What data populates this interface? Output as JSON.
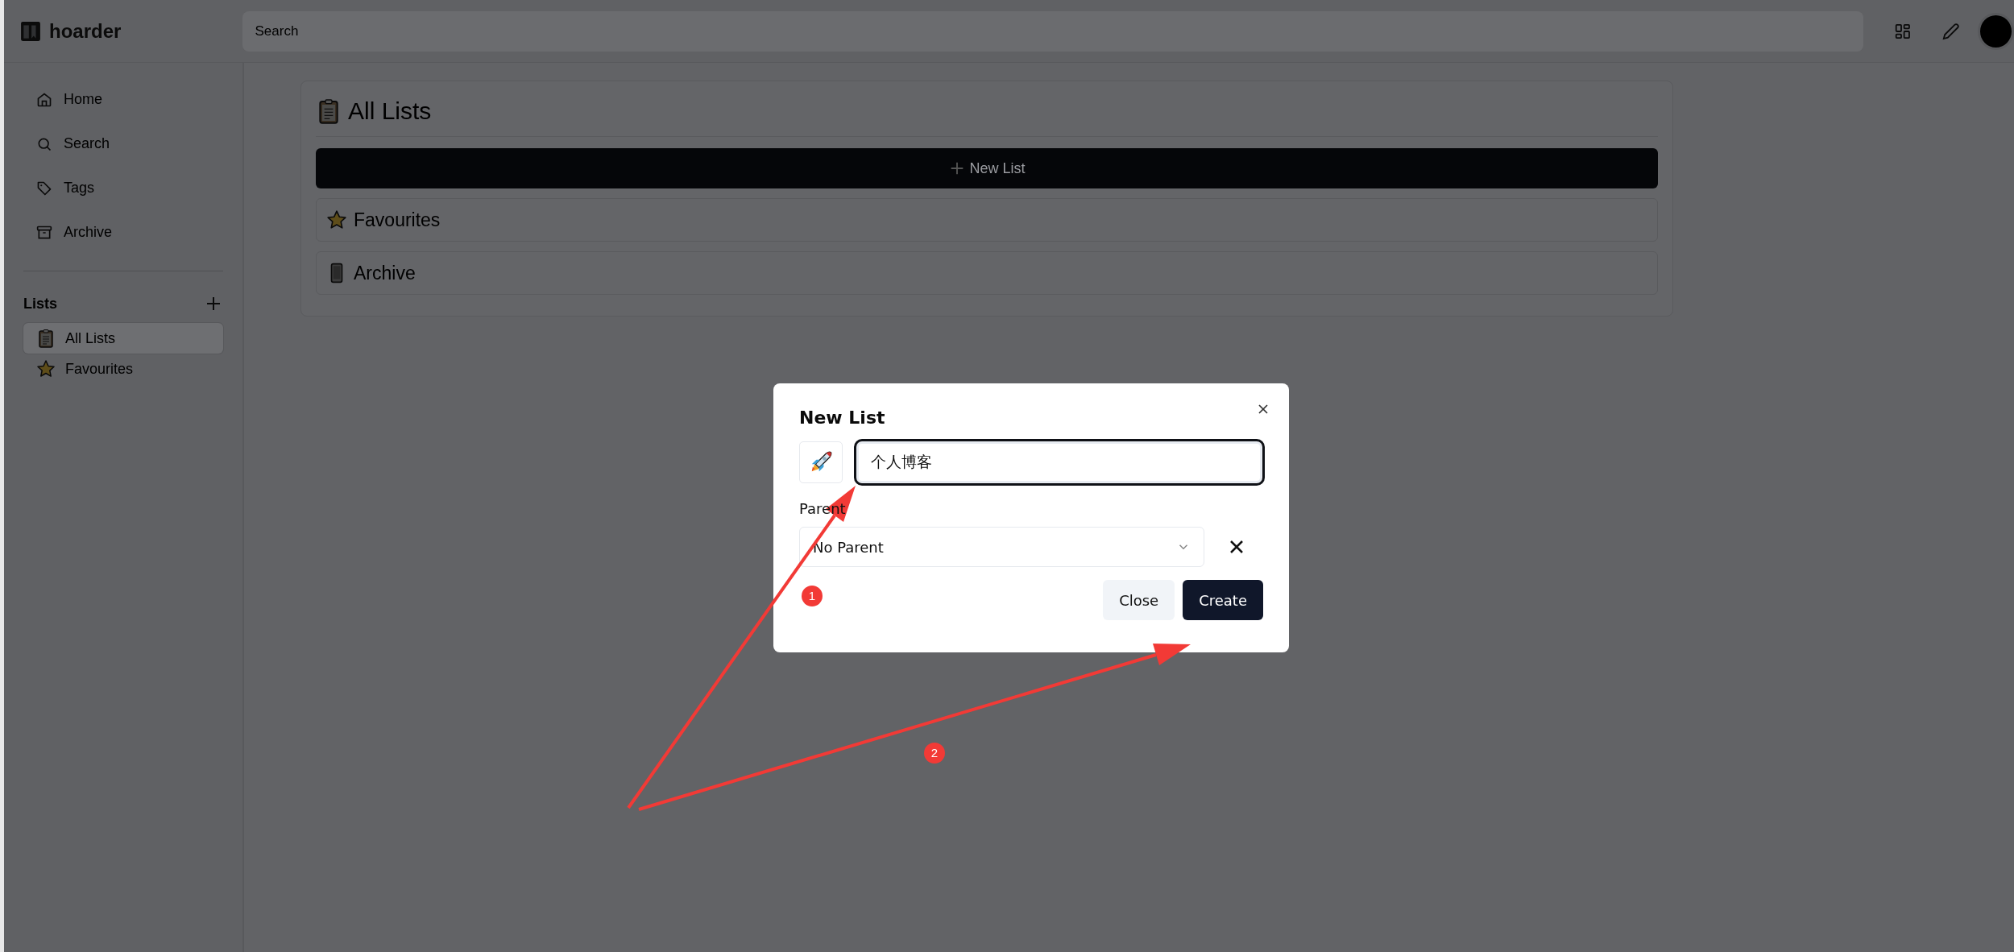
{
  "app": {
    "logo": "hoarder"
  },
  "search": {
    "placeholder": "Search"
  },
  "sidebar": {
    "items": [
      {
        "label": "Home"
      },
      {
        "label": "Search"
      },
      {
        "label": "Tags"
      },
      {
        "label": "Archive"
      }
    ],
    "lists_heading": "Lists",
    "lists": [
      {
        "label": "All Lists",
        "selected": true
      },
      {
        "label": "Favourites",
        "selected": false
      }
    ]
  },
  "page": {
    "title": "All Lists",
    "new_list_button": "New List",
    "lists": [
      {
        "label": "Favourites"
      },
      {
        "label": "Archive"
      }
    ]
  },
  "dialog": {
    "title": "New List",
    "name_value": "个人博客",
    "parent_label": "Parent",
    "parent_value": "No Parent",
    "buttons": [
      {
        "label": "Close",
        "kind": "secondary"
      },
      {
        "label": "Create",
        "kind": "primary"
      }
    ]
  },
  "annotations": [
    {
      "label": "1"
    },
    {
      "label": "2"
    }
  ]
}
